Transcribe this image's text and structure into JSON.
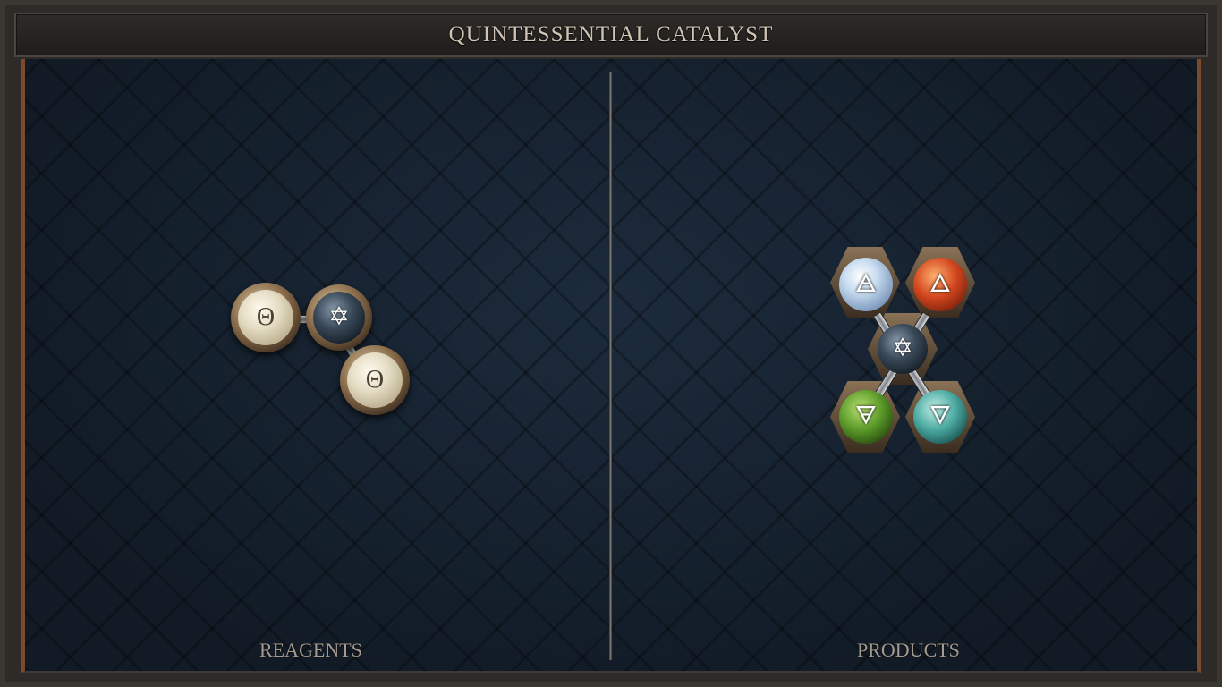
{
  "title": "QUINTESSENTIAL CATALYST",
  "reagents_label": "REAGENTS",
  "products_label": "PRODUCTS",
  "reagent_atoms": [
    {
      "element": "salt",
      "glyph": "Θ"
    },
    {
      "element": "quintessence",
      "glyph": "✡"
    },
    {
      "element": "salt",
      "glyph": "Θ"
    }
  ],
  "product_atoms": [
    {
      "element": "air",
      "glyph": "🜁"
    },
    {
      "element": "fire",
      "glyph": "🜂"
    },
    {
      "element": "quintessence",
      "glyph": "✡"
    },
    {
      "element": "earth",
      "glyph": "🜃"
    },
    {
      "element": "water",
      "glyph": "🜄"
    }
  ],
  "colors": {
    "salt": "#e4dcc4",
    "quintessence": "#3a4a5a",
    "air": "#c8dcf0",
    "fire": "#d2461e",
    "earth": "#5a9a28",
    "water": "#4aa8a0"
  }
}
